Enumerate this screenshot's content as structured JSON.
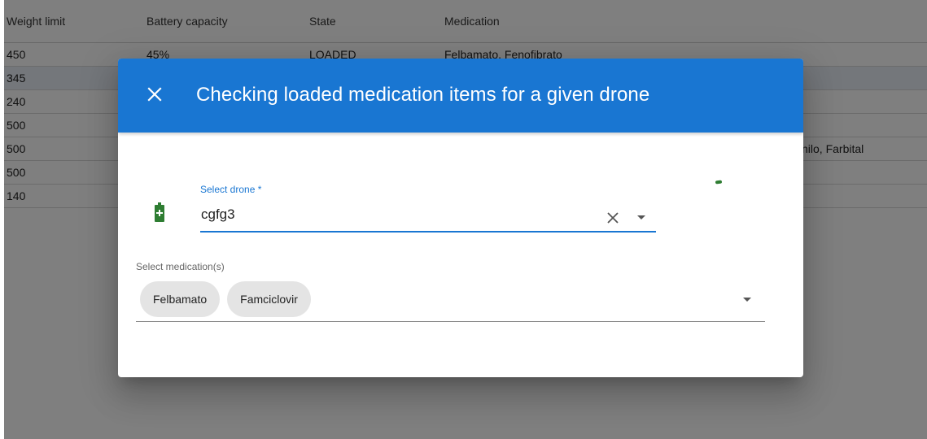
{
  "table": {
    "headers": [
      "Weight limit",
      "Battery capacity",
      "State",
      "Medication"
    ],
    "rows": [
      {
        "weight": "450",
        "battery": "45%",
        "state": "LOADED",
        "medication": "Felbamato, Fenofibrato"
      },
      {
        "weight": "345",
        "battery": "",
        "state": "",
        "medication": ""
      },
      {
        "weight": "240",
        "battery": "",
        "state": "",
        "medication": ""
      },
      {
        "weight": "500",
        "battery": "",
        "state": "",
        "medication": ""
      },
      {
        "weight": "500",
        "battery": "",
        "state": "",
        "medication": "",
        "medication_tail": "nilo, Farbital"
      },
      {
        "weight": "500",
        "battery": "",
        "state": "",
        "medication": ""
      },
      {
        "weight": "140",
        "battery": "",
        "state": "",
        "medication": ""
      }
    ]
  },
  "dialog": {
    "title": "Checking loaded medication items for a given drone",
    "close_icon": "close-icon",
    "drone_field": {
      "label": "Select drone *",
      "value": "cgfg3",
      "icon": "battery-plus-icon"
    },
    "medication_field": {
      "label": "Select medication(s)",
      "chips": [
        "Felbamato",
        "Famciclovir"
      ]
    }
  },
  "colors": {
    "primary": "#1976d2",
    "battery_green": "#2e7d32",
    "chip_bg": "#e4e4e4",
    "overlay": "rgba(0,0,0,0.5)"
  }
}
